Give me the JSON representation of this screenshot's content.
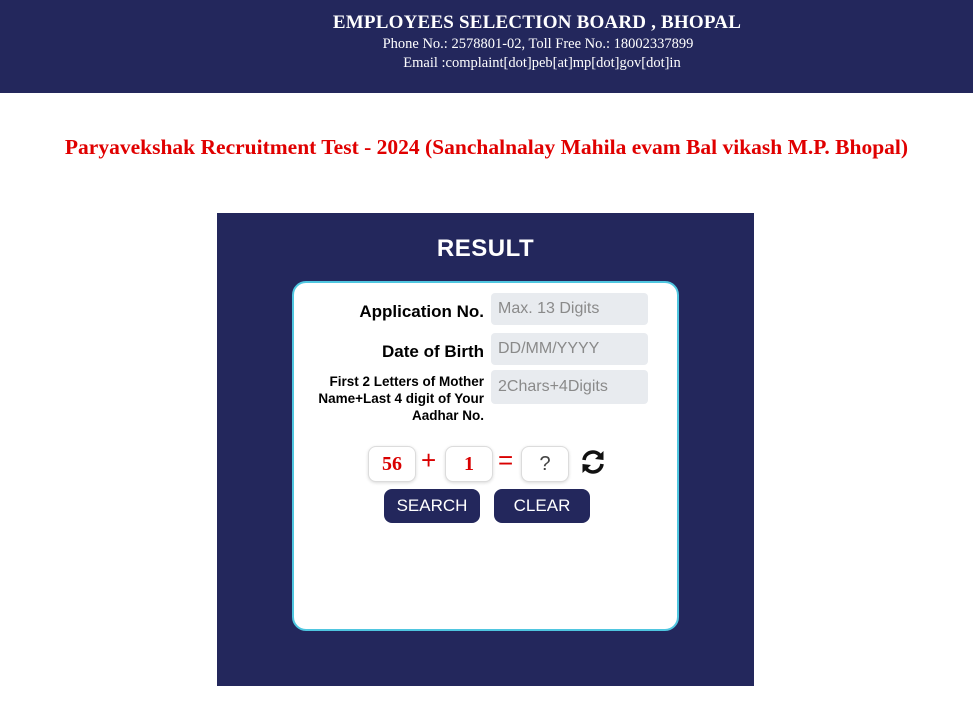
{
  "header": {
    "title": "EMPLOYEES SELECTION BOARD , BHOPAL",
    "phone": "Phone No.: 2578801-02, Toll Free No.: 18002337899",
    "email": "Email :complaint[dot]peb[at]mp[dot]gov[dot]in",
    "background_color": "#23275c"
  },
  "page_title": "Paryavekshak Recruitment Test - 2024 (Sanchalnalay Mahila evam Bal vikash M.P. Bhopal)",
  "result_panel": {
    "title": "RESULT",
    "form": {
      "application_no": {
        "label": "Application No.",
        "placeholder": "Max. 13 Digits",
        "value": ""
      },
      "date_of_birth": {
        "label": "Date of Birth",
        "placeholder": "DD/MM/YYYY",
        "value": ""
      },
      "mother_aadhar": {
        "label": "First 2 Letters of Mother Name+Last 4 digit of Your Aadhar No.",
        "placeholder": "2Chars+4Digits",
        "value": ""
      },
      "captcha": {
        "operand_a": "56",
        "operator": "+",
        "operand_b": "1",
        "equals": "=",
        "answer_placeholder": "?",
        "refresh_icon": "refresh-icon"
      },
      "buttons": {
        "search": "SEARCH",
        "clear": "CLEAR"
      }
    },
    "accent_color": "#4fc6e0",
    "captcha_color": "#d90000"
  }
}
